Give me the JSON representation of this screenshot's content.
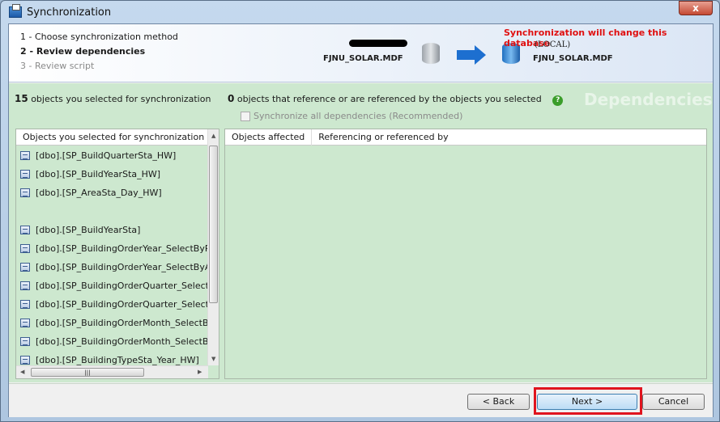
{
  "window": {
    "title": "Synchronization",
    "close_label": "x"
  },
  "steps": [
    "1 - Choose synchronization method",
    "2 - Review dependencies",
    "3 - Review script"
  ],
  "header": {
    "warning": "Synchronization will change this database",
    "source_db": "FJNU_SOLAR.MDF",
    "target_server": "(LOCAL)",
    "target_db": "FJNU_SOLAR.MDF",
    "warning_color": "#e01010"
  },
  "summary": {
    "selected_count": "15",
    "selected_text": "objects you selected for synchronization",
    "dep_count": "0",
    "dep_text": "objects that reference or are referenced by the objects you selected",
    "sync_all_label": "Synchronize all dependencies (Recommended)",
    "sync_all_checked": false,
    "watermark": "Dependencies"
  },
  "left_list": {
    "header": "Objects you selected for synchronization",
    "items": [
      "[dbo].[SP_BuildQuarterSta_HW]",
      "[dbo].[SP_BuildYearSta_HW]",
      "[dbo].[SP_AreaSta_Day_HW]",
      "",
      "[dbo].[SP_BuildYearSta]",
      "[dbo].[SP_BuildingOrderYear_SelectByPro",
      "[dbo].[SP_BuildingOrderYear_SelectByAr",
      "[dbo].[SP_BuildingOrderQuarter_SelectBy",
      "[dbo].[SP_BuildingOrderQuarter_SelectBy",
      "[dbo].[SP_BuildingOrderMonth_SelectBy",
      "[dbo].[SP_BuildingOrderMonth_SelectBy",
      "[dbo].[SP_BuildingTypeSta_Year_HW]"
    ]
  },
  "right_list": {
    "col1": "Objects affected",
    "col2": "Referencing or referenced by"
  },
  "buttons": {
    "back": "< Back",
    "next": "Next >",
    "cancel": "Cancel"
  }
}
